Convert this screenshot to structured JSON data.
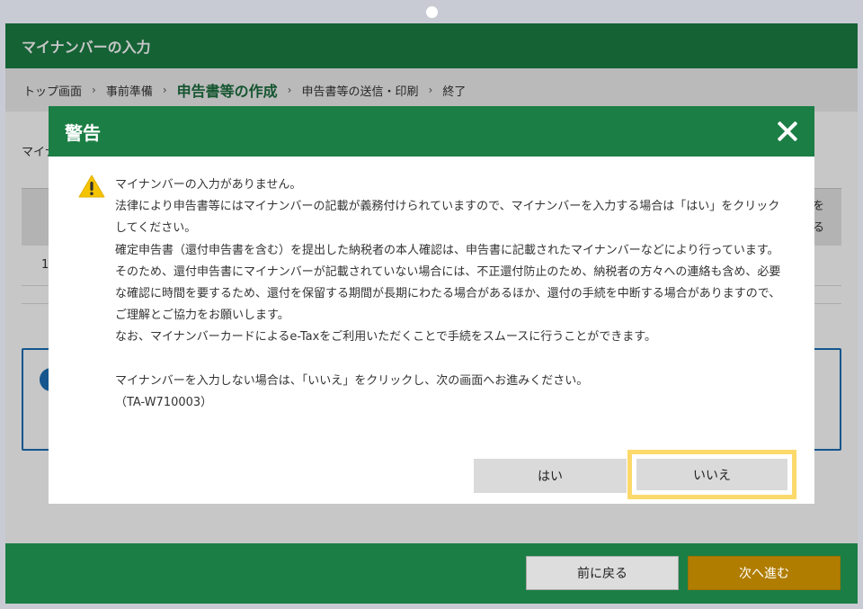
{
  "app": {
    "title": "マイナンバーの入力"
  },
  "breadcrumb": {
    "items": [
      "トップ画面",
      "事前準備",
      "申告書等の作成",
      "申告書等の送信・印刷",
      "終了"
    ],
    "separator": "›"
  },
  "background": {
    "label_partial": "マイナ",
    "row_number": "1",
    "edge_text_1": "を",
    "edge_text_2": "る"
  },
  "footer": {
    "back_label": "前に戻る",
    "next_label": "次へ進む"
  },
  "modal": {
    "title": "警告",
    "close_icon": "close-icon",
    "warning_icon": "warning-triangle-icon",
    "messages": [
      "マイナンバーの入力がありません。",
      "法律により申告書等にはマイナンバーの記載が義務付けられていますので、マイナンバーを入力する場合は「はい」をクリックしてください。",
      "確定申告書（還付申告書を含む）を提出した納税者の本人確認は、申告書に記載されたマイナンバーなどにより行っています。そのため、還付申告書にマイナンバーが記載されていない場合には、不正還付防止のため、納税者の方々への連絡も含め、必要な確認に時間を要するため、還付を保留する期間が長期にわたる場合があるほか、還付の手続を中断する場合がありますので、ご理解とご協力をお願いします。",
      "なお、マイナンバーカードによるe-Taxをご利用いただくことで手続をスムースに行うことができます。"
    ],
    "instruction": "マイナンバーを入力しない場合は、「いいえ」をクリックし、次の画面へお進みください。",
    "code": "（TA-W710003）",
    "yes_label": "はい",
    "no_label": "いいえ"
  },
  "colors": {
    "header_green": "#1b7e45",
    "next_button": "#b07d00",
    "focus_highlight": "#fbd96b",
    "warning_yellow": "#f5c400"
  }
}
